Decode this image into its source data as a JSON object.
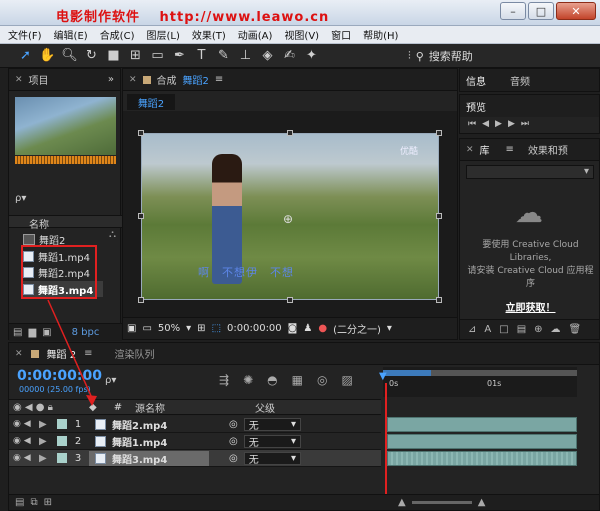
{
  "watermark": "电影制作软件　 http://www.leawo.cn",
  "menus": [
    "文件(F)",
    "编辑(E)",
    "合成(C)",
    "图层(L)",
    "效果(T)",
    "动画(A)",
    "视图(V)",
    "窗口",
    "帮助(H)"
  ],
  "toolbar": {
    "search_label": "搜索帮助"
  },
  "project": {
    "tab_label": "项目",
    "search_placeholder": "ρ▾",
    "col_name": "名称",
    "items": [
      {
        "name": "舞蹈2",
        "type": "comp"
      },
      {
        "name": "舞蹈1.mp4",
        "type": "file"
      },
      {
        "name": "舞蹈2.mp4",
        "type": "file"
      },
      {
        "name": "舞蹈3.mp4",
        "type": "file",
        "selected": true
      }
    ],
    "bpc": "8 bpc"
  },
  "composition": {
    "tab_prefix": "合成",
    "tab_name": "舞蹈2",
    "view_tab": "舞蹈2",
    "caption": "啊　不想伊　不想",
    "watermark_logo": "优酷",
    "zoom": "50%",
    "timecode": "0:00:00:00",
    "resolution": "(二分之一)"
  },
  "right": {
    "info_tab": "信息",
    "audio_tab": "音频",
    "preview_tab": "预览",
    "library_tab": "库",
    "effects_tab": "效果和预",
    "library_msg_1": "要使用 Creative Cloud",
    "library_msg_2": "Libraries,",
    "library_msg_3": "请安装 Creative Cloud 应用程",
    "library_msg_4": "序",
    "library_link": "立即获取！"
  },
  "timeline": {
    "tab_comp": "舞蹈 2",
    "tab_render": "渲染队列",
    "timecode": "0:00:00:00",
    "fps": "00000 (25.00 fps)",
    "ruler_0": "0s",
    "ruler_1": "01s",
    "col_num": "#",
    "col_source": "源名称",
    "col_parent": "父级",
    "layers": [
      {
        "num": "1",
        "name": "舞蹈2.mp4",
        "parent": "无"
      },
      {
        "num": "2",
        "name": "舞蹈1.mp4",
        "parent": "无"
      },
      {
        "num": "3",
        "name": "舞蹈3.mp4",
        "parent": "无",
        "selected": true
      }
    ]
  },
  "colors": {
    "accent": "#4aa3ff",
    "highlight_red": "#e02020",
    "layer_bar": "#7aa6a3"
  }
}
